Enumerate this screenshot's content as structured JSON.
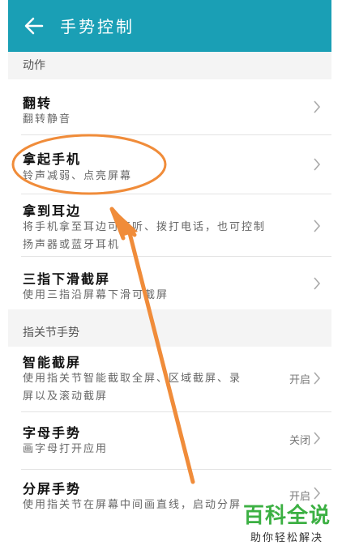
{
  "header": {
    "title": "手势控制"
  },
  "sections": [
    {
      "label": "动作",
      "items": [
        {
          "title": "翻转",
          "subtitle": [
            "翻转静音"
          ]
        },
        {
          "title": "拿起手机",
          "subtitle": [
            "铃声减弱、点亮屏幕"
          ]
        },
        {
          "title": "拿到耳边",
          "subtitle": [
            "将手机拿至耳边可接听、拨打电话，也可控制",
            "扬声器或蓝牙耳机"
          ]
        },
        {
          "title": "三指下滑截屏",
          "subtitle": [
            "使用三指沿屏幕下滑可截屏"
          ]
        }
      ]
    },
    {
      "label": "指关节手势",
      "items": [
        {
          "title": "智能截屏",
          "subtitle": [
            "使用指关节智能截取全屏、区域截屏、录",
            "屏以及滚动截屏"
          ],
          "status": "开启"
        },
        {
          "title": "字母手势",
          "subtitle": [
            "画字母打开应用"
          ],
          "status": "关闭"
        },
        {
          "title": "分屏手势",
          "subtitle": [
            "使用指关节在屏幕中间画直线，启动分屏"
          ],
          "status": "开启"
        }
      ]
    }
  ],
  "watermark": {
    "logo": "百科全说",
    "tagline": "助你轻松解决"
  },
  "colors": {
    "appbar": "#1a9fb5",
    "annotation": "#f08c3a",
    "watermark": "#3cb043"
  }
}
